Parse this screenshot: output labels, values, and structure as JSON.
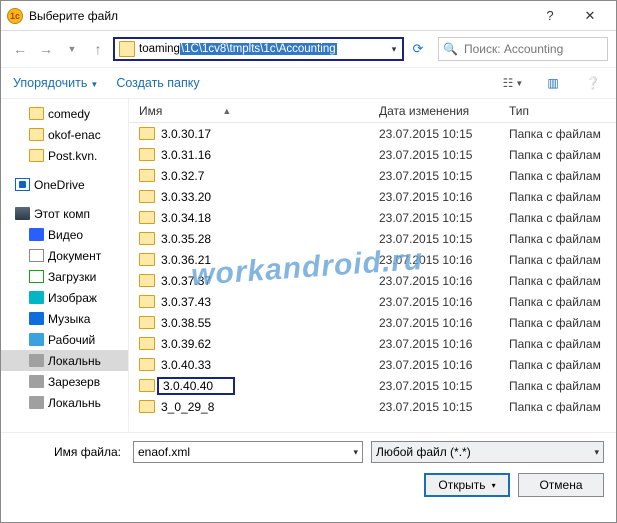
{
  "window": {
    "title": "Выберите файл"
  },
  "address": {
    "prefix": "toaming",
    "highlighted": "\\1C\\1cv8\\tmplts\\1c\\Accounting"
  },
  "search": {
    "placeholder": "Поиск: Accounting"
  },
  "commands": {
    "organize": "Упорядочить",
    "newfolder": "Создать папку"
  },
  "columns": {
    "name": "Имя",
    "date": "Дата изменения",
    "type": "Тип"
  },
  "tree": {
    "comedy": "comedy",
    "okof": "okof-enac",
    "post": "Post.kvn.",
    "onedrive": "OneDrive",
    "thispc": "Этот комп",
    "video": "Видео",
    "docs": "Документ",
    "downloads": "Загрузки",
    "images": "Изображ",
    "music": "Музыка",
    "desktop": "Рабочий",
    "local1": "Локальнь",
    "reserved": "Зарезерв",
    "local2": "Локальнь"
  },
  "files": [
    {
      "name": "3.0.30.17",
      "date": "23.07.2015 10:15",
      "type": "Папка с файлам"
    },
    {
      "name": "3.0.31.16",
      "date": "23.07.2015 10:15",
      "type": "Папка с файлам"
    },
    {
      "name": "3.0.32.7",
      "date": "23.07.2015 10:15",
      "type": "Папка с файлам"
    },
    {
      "name": "3.0.33.20",
      "date": "23.07.2015 10:16",
      "type": "Папка с файлам"
    },
    {
      "name": "3.0.34.18",
      "date": "23.07.2015 10:15",
      "type": "Папка с файлам"
    },
    {
      "name": "3.0.35.28",
      "date": "23.07.2015 10:15",
      "type": "Папка с файлам"
    },
    {
      "name": "3.0.36.21",
      "date": "23.07.2015 10:16",
      "type": "Папка с файлам"
    },
    {
      "name": "3.0.37.37",
      "date": "23.07.2015 10:16",
      "type": "Папка с файлам"
    },
    {
      "name": "3.0.37.43",
      "date": "23.07.2015 10:16",
      "type": "Папка с файлам"
    },
    {
      "name": "3.0.38.55",
      "date": "23.07.2015 10:16",
      "type": "Папка с файлам"
    },
    {
      "name": "3.0.39.62",
      "date": "23.07.2015 10:16",
      "type": "Папка с файлам"
    },
    {
      "name": "3.0.40.33",
      "date": "23.07.2015 10:16",
      "type": "Папка с файлам"
    },
    {
      "name": "3.0.40.40",
      "date": "23.07.2015 10:15",
      "type": "Папка с файлам",
      "selected": true
    },
    {
      "name": "3_0_29_8",
      "date": "23.07.2015 10:15",
      "type": "Папка с файлам"
    }
  ],
  "footer": {
    "filename_label": "Имя файла:",
    "filename_value": "enaof.xml",
    "filter_value": "Любой файл (*.*)",
    "open": "Открыть",
    "cancel": "Отмена"
  },
  "watermark": "workandroid.ru"
}
